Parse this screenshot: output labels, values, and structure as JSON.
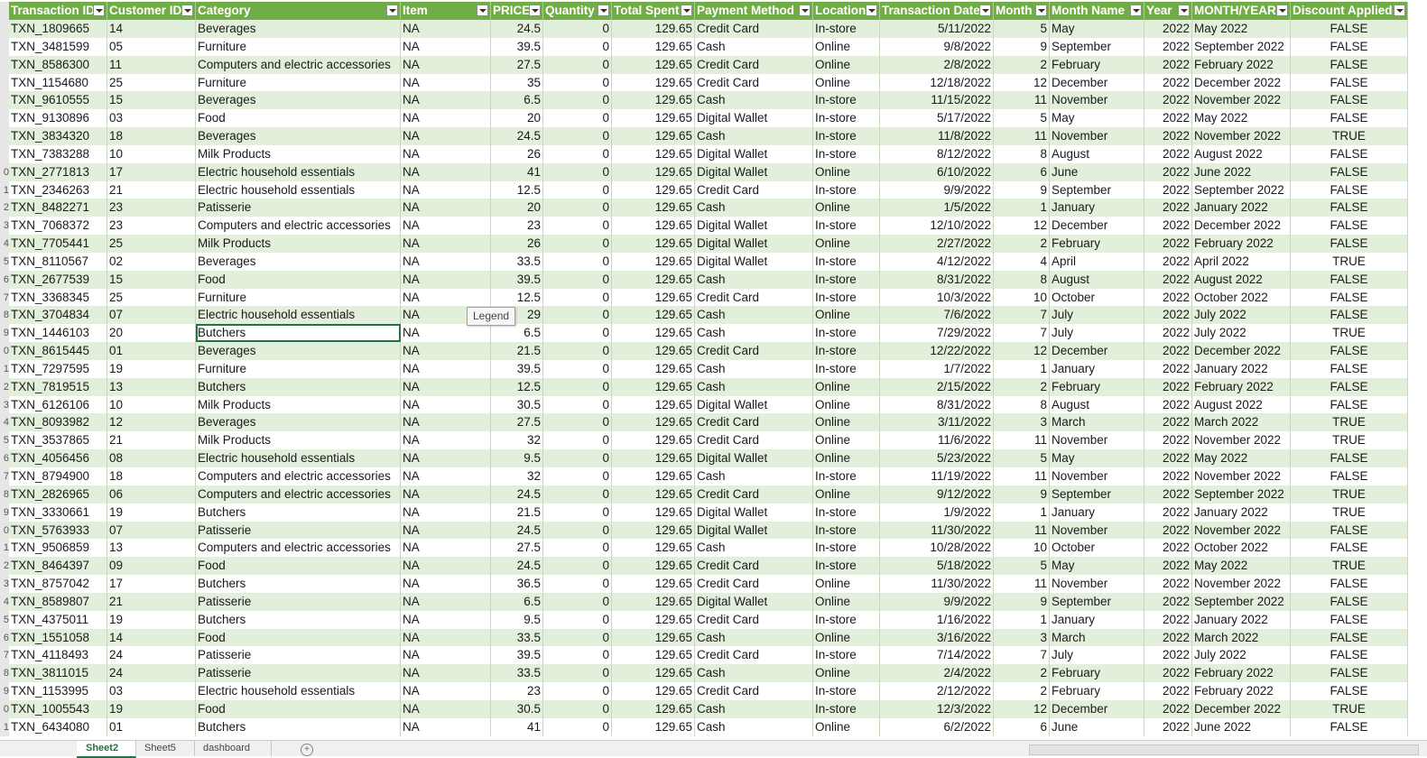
{
  "columns": [
    "Transaction ID",
    "Customer ID",
    "Category",
    "Item",
    "PRICE",
    "Quantity",
    "Total Spent",
    "Payment Method",
    "Location",
    "Transaction Date",
    "Month",
    "Month Name",
    "Year",
    "MONTH/YEAR",
    "Discount Applied"
  ],
  "row_numbers": [
    "",
    "",
    "",
    "",
    "",
    "",
    "",
    "",
    "",
    "0",
    "1",
    "2",
    "3",
    "4",
    "5",
    "6",
    "7",
    "8",
    "9",
    "0",
    "1",
    "2",
    "3",
    "4",
    "5",
    "6",
    "7",
    "8",
    "9",
    "0",
    "1",
    "2",
    "3",
    "4",
    "5",
    "6",
    "7",
    "8",
    "9",
    "0",
    "1"
  ],
  "rows": [
    [
      "TXN_1809665",
      "14",
      "Beverages",
      "NA",
      "24.5",
      "0",
      "129.65",
      "Credit Card",
      "In-store",
      "5/11/2022",
      "5",
      "May",
      "2022",
      "May 2022",
      "FALSE"
    ],
    [
      "TXN_3481599",
      "05",
      "Furniture",
      "NA",
      "39.5",
      "0",
      "129.65",
      "Cash",
      "Online",
      "9/8/2022",
      "9",
      "September",
      "2022",
      "September 2022",
      "FALSE"
    ],
    [
      "TXN_8586300",
      "11",
      "Computers and electric accessories",
      "NA",
      "27.5",
      "0",
      "129.65",
      "Credit Card",
      "Online",
      "2/8/2022",
      "2",
      "February",
      "2022",
      "February 2022",
      "FALSE"
    ],
    [
      "TXN_1154680",
      "25",
      "Furniture",
      "NA",
      "35",
      "0",
      "129.65",
      "Credit Card",
      "Online",
      "12/18/2022",
      "12",
      "December",
      "2022",
      "December 2022",
      "FALSE"
    ],
    [
      "TXN_9610555",
      "15",
      "Beverages",
      "NA",
      "6.5",
      "0",
      "129.65",
      "Cash",
      "In-store",
      "11/15/2022",
      "11",
      "November",
      "2022",
      "November 2022",
      "FALSE"
    ],
    [
      "TXN_9130896",
      "03",
      "Food",
      "NA",
      "20",
      "0",
      "129.65",
      "Digital Wallet",
      "In-store",
      "5/17/2022",
      "5",
      "May",
      "2022",
      "May 2022",
      "FALSE"
    ],
    [
      "TXN_3834320",
      "18",
      "Beverages",
      "NA",
      "24.5",
      "0",
      "129.65",
      "Cash",
      "In-store",
      "11/8/2022",
      "11",
      "November",
      "2022",
      "November 2022",
      "TRUE"
    ],
    [
      "TXN_7383288",
      "10",
      "Milk Products",
      "NA",
      "26",
      "0",
      "129.65",
      "Digital Wallet",
      "In-store",
      "8/12/2022",
      "8",
      "August",
      "2022",
      "August 2022",
      "FALSE"
    ],
    [
      "TXN_2771813",
      "17",
      "Electric household essentials",
      "NA",
      "41",
      "0",
      "129.65",
      "Digital Wallet",
      "Online",
      "6/10/2022",
      "6",
      "June",
      "2022",
      "June 2022",
      "FALSE"
    ],
    [
      "TXN_2346263",
      "21",
      "Electric household essentials",
      "NA",
      "12.5",
      "0",
      "129.65",
      "Credit Card",
      "In-store",
      "9/9/2022",
      "9",
      "September",
      "2022",
      "September 2022",
      "FALSE"
    ],
    [
      "TXN_8482271",
      "23",
      "Patisserie",
      "NA",
      "20",
      "0",
      "129.65",
      "Cash",
      "Online",
      "1/5/2022",
      "1",
      "January",
      "2022",
      "January 2022",
      "FALSE"
    ],
    [
      "TXN_7068372",
      "23",
      "Computers and electric accessories",
      "NA",
      "23",
      "0",
      "129.65",
      "Digital Wallet",
      "In-store",
      "12/10/2022",
      "12",
      "December",
      "2022",
      "December 2022",
      "FALSE"
    ],
    [
      "TXN_7705441",
      "25",
      "Milk Products",
      "NA",
      "26",
      "0",
      "129.65",
      "Digital Wallet",
      "Online",
      "2/27/2022",
      "2",
      "February",
      "2022",
      "February 2022",
      "FALSE"
    ],
    [
      "TXN_8110567",
      "02",
      "Beverages",
      "NA",
      "33.5",
      "0",
      "129.65",
      "Digital Wallet",
      "In-store",
      "4/12/2022",
      "4",
      "April",
      "2022",
      "April 2022",
      "TRUE"
    ],
    [
      "TXN_2677539",
      "15",
      "Food",
      "NA",
      "39.5",
      "0",
      "129.65",
      "Cash",
      "In-store",
      "8/31/2022",
      "8",
      "August",
      "2022",
      "August 2022",
      "FALSE"
    ],
    [
      "TXN_3368345",
      "25",
      "Furniture",
      "NA",
      "12.5",
      "0",
      "129.65",
      "Credit Card",
      "In-store",
      "10/3/2022",
      "10",
      "October",
      "2022",
      "October 2022",
      "FALSE"
    ],
    [
      "TXN_3704834",
      "07",
      "Electric household essentials",
      "NA",
      "29",
      "0",
      "129.65",
      "Cash",
      "Online",
      "7/6/2022",
      "7",
      "July",
      "2022",
      "July 2022",
      "FALSE"
    ],
    [
      "TXN_1446103",
      "20",
      "Butchers",
      "NA",
      "6.5",
      "0",
      "129.65",
      "Cash",
      "In-store",
      "7/29/2022",
      "7",
      "July",
      "2022",
      "July 2022",
      "TRUE"
    ],
    [
      "TXN_8615445",
      "01",
      "Beverages",
      "NA",
      "21.5",
      "0",
      "129.65",
      "Credit Card",
      "In-store",
      "12/22/2022",
      "12",
      "December",
      "2022",
      "December 2022",
      "FALSE"
    ],
    [
      "TXN_7297595",
      "19",
      "Furniture",
      "NA",
      "39.5",
      "0",
      "129.65",
      "Cash",
      "In-store",
      "1/7/2022",
      "1",
      "January",
      "2022",
      "January 2022",
      "FALSE"
    ],
    [
      "TXN_7819515",
      "13",
      "Butchers",
      "NA",
      "12.5",
      "0",
      "129.65",
      "Cash",
      "Online",
      "2/15/2022",
      "2",
      "February",
      "2022",
      "February 2022",
      "FALSE"
    ],
    [
      "TXN_6126106",
      "10",
      "Milk Products",
      "NA",
      "30.5",
      "0",
      "129.65",
      "Digital Wallet",
      "Online",
      "8/31/2022",
      "8",
      "August",
      "2022",
      "August 2022",
      "FALSE"
    ],
    [
      "TXN_8093982",
      "12",
      "Beverages",
      "NA",
      "27.5",
      "0",
      "129.65",
      "Credit Card",
      "Online",
      "3/11/2022",
      "3",
      "March",
      "2022",
      "March 2022",
      "TRUE"
    ],
    [
      "TXN_3537865",
      "21",
      "Milk Products",
      "NA",
      "32",
      "0",
      "129.65",
      "Credit Card",
      "Online",
      "11/6/2022",
      "11",
      "November",
      "2022",
      "November 2022",
      "TRUE"
    ],
    [
      "TXN_4056456",
      "08",
      "Electric household essentials",
      "NA",
      "9.5",
      "0",
      "129.65",
      "Digital Wallet",
      "Online",
      "5/23/2022",
      "5",
      "May",
      "2022",
      "May 2022",
      "FALSE"
    ],
    [
      "TXN_8794900",
      "18",
      "Computers and electric accessories",
      "NA",
      "32",
      "0",
      "129.65",
      "Cash",
      "In-store",
      "11/19/2022",
      "11",
      "November",
      "2022",
      "November 2022",
      "FALSE"
    ],
    [
      "TXN_2826965",
      "06",
      "Computers and electric accessories",
      "NA",
      "24.5",
      "0",
      "129.65",
      "Credit Card",
      "Online",
      "9/12/2022",
      "9",
      "September",
      "2022",
      "September 2022",
      "TRUE"
    ],
    [
      "TXN_3330661",
      "19",
      "Butchers",
      "NA",
      "21.5",
      "0",
      "129.65",
      "Digital Wallet",
      "In-store",
      "1/9/2022",
      "1",
      "January",
      "2022",
      "January 2022",
      "TRUE"
    ],
    [
      "TXN_5763933",
      "07",
      "Patisserie",
      "NA",
      "24.5",
      "0",
      "129.65",
      "Digital Wallet",
      "In-store",
      "11/30/2022",
      "11",
      "November",
      "2022",
      "November 2022",
      "FALSE"
    ],
    [
      "TXN_9506859",
      "13",
      "Computers and electric accessories",
      "NA",
      "27.5",
      "0",
      "129.65",
      "Cash",
      "In-store",
      "10/28/2022",
      "10",
      "October",
      "2022",
      "October 2022",
      "FALSE"
    ],
    [
      "TXN_8464397",
      "09",
      "Food",
      "NA",
      "24.5",
      "0",
      "129.65",
      "Credit Card",
      "In-store",
      "5/18/2022",
      "5",
      "May",
      "2022",
      "May 2022",
      "TRUE"
    ],
    [
      "TXN_8757042",
      "17",
      "Butchers",
      "NA",
      "36.5",
      "0",
      "129.65",
      "Credit Card",
      "Online",
      "11/30/2022",
      "11",
      "November",
      "2022",
      "November 2022",
      "FALSE"
    ],
    [
      "TXN_8589807",
      "21",
      "Patisserie",
      "NA",
      "6.5",
      "0",
      "129.65",
      "Digital Wallet",
      "Online",
      "9/9/2022",
      "9",
      "September",
      "2022",
      "September 2022",
      "FALSE"
    ],
    [
      "TXN_4375011",
      "19",
      "Butchers",
      "NA",
      "9.5",
      "0",
      "129.65",
      "Credit Card",
      "In-store",
      "1/16/2022",
      "1",
      "January",
      "2022",
      "January 2022",
      "FALSE"
    ],
    [
      "TXN_1551058",
      "14",
      "Food",
      "NA",
      "33.5",
      "0",
      "129.65",
      "Cash",
      "Online",
      "3/16/2022",
      "3",
      "March",
      "2022",
      "March 2022",
      "FALSE"
    ],
    [
      "TXN_4118493",
      "24",
      "Patisserie",
      "NA",
      "39.5",
      "0",
      "129.65",
      "Credit Card",
      "In-store",
      "7/14/2022",
      "7",
      "July",
      "2022",
      "July 2022",
      "FALSE"
    ],
    [
      "TXN_3811015",
      "24",
      "Patisserie",
      "NA",
      "33.5",
      "0",
      "129.65",
      "Cash",
      "Online",
      "2/4/2022",
      "2",
      "February",
      "2022",
      "February 2022",
      "FALSE"
    ],
    [
      "TXN_1153995",
      "03",
      "Electric household essentials",
      "NA",
      "23",
      "0",
      "129.65",
      "Credit Card",
      "In-store",
      "2/12/2022",
      "2",
      "February",
      "2022",
      "February 2022",
      "FALSE"
    ],
    [
      "TXN_1005543",
      "19",
      "Food",
      "NA",
      "30.5",
      "0",
      "129.65",
      "Cash",
      "In-store",
      "12/3/2022",
      "12",
      "December",
      "2022",
      "December 2022",
      "TRUE"
    ],
    [
      "TXN_6434080",
      "01",
      "Butchers",
      "NA",
      "41",
      "0",
      "129.65",
      "Cash",
      "Online",
      "6/2/2022",
      "6",
      "June",
      "2022",
      "June 2022",
      "FALSE"
    ]
  ],
  "tooltip": "Legend",
  "sheet_tabs": [
    "Sheet2",
    "Sheet5",
    "dashboard"
  ],
  "active_tab_index": 0,
  "add_sheet_icon": "plus-circle-icon",
  "colors": {
    "header_bg": "#70ad47",
    "band_green": "#e2efda",
    "accent": "#217346"
  }
}
